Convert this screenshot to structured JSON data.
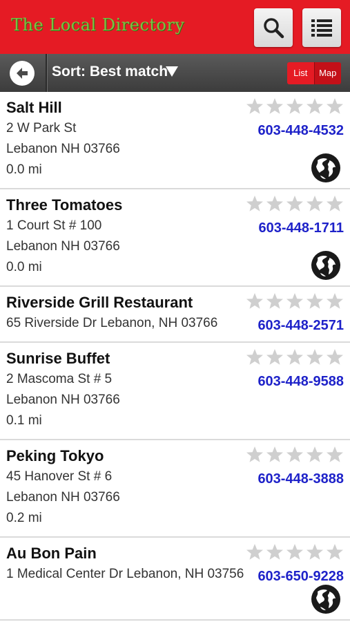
{
  "app": {
    "title": "The Local Directory"
  },
  "header": {
    "search_icon": "search-icon",
    "list_icon": "list-icon"
  },
  "sortbar": {
    "back_icon": "back-arrow-icon",
    "sort_label": "Sort: Best match",
    "toggle": {
      "list": "List",
      "map": "Map",
      "selected": "List"
    }
  },
  "colors": {
    "brand_red": "#e51b24",
    "title_green": "#7ac043",
    "phone_blue": "#1e22c9",
    "star_gray": "#cfcfcf"
  },
  "listings": [
    {
      "name": "Salt Hill",
      "lines": [
        "2 W Park St",
        "Lebanon NH 03766",
        "0.0 mi"
      ],
      "phone": "603-448-4532",
      "rating": 0,
      "has_globe": true
    },
    {
      "name": "Three Tomatoes",
      "lines": [
        "1 Court St # 100",
        "Lebanon NH 03766",
        "0.0 mi"
      ],
      "phone": "603-448-1711",
      "rating": 0,
      "has_globe": true
    },
    {
      "name": "Riverside Grill Restaurant",
      "lines": [
        "65 Riverside Dr Lebanon, NH 03766"
      ],
      "phone": "603-448-2571",
      "rating": 0,
      "has_globe": false
    },
    {
      "name": "Sunrise Buffet",
      "lines": [
        "2 Mascoma St # 5",
        "Lebanon NH 03766",
        "0.1 mi"
      ],
      "phone": "603-448-9588",
      "rating": 0,
      "has_globe": false
    },
    {
      "name": "Peking Tokyo",
      "lines": [
        "45 Hanover St # 6",
        "Lebanon NH 03766",
        "0.2 mi"
      ],
      "phone": "603-448-3888",
      "rating": 0,
      "has_globe": false
    },
    {
      "name": "Au Bon Pain",
      "lines": [
        "1 Medical Center Dr Lebanon, NH 03756"
      ],
      "phone": "603-650-9228",
      "rating": 0,
      "has_globe": true
    }
  ]
}
